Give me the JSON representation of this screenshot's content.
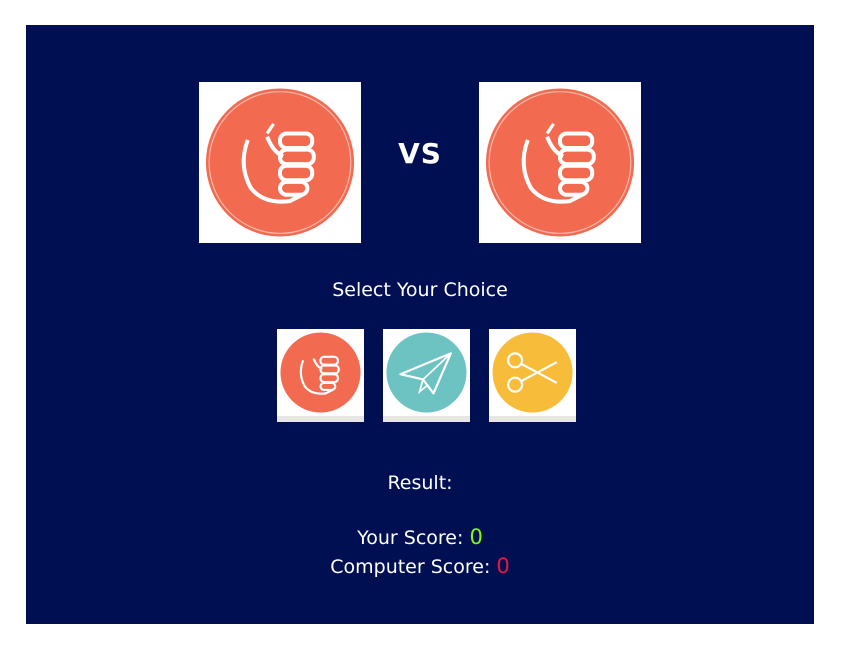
{
  "versus_label": "VS",
  "select_label": "Select Your Choice",
  "result_label": "Result:",
  "player_choice_icon": "rock-fist-icon",
  "computer_choice_icon": "rock-fist-icon",
  "choices": [
    {
      "name": "rock",
      "icon": "rock-fist-icon",
      "color": "#f26a4f"
    },
    {
      "name": "paper",
      "icon": "paper-plane-icon",
      "color": "#6cc3c1"
    },
    {
      "name": "scissors",
      "icon": "scissors-icon",
      "color": "#f7bd3a"
    }
  ],
  "scores": {
    "player_label": "Your Score:",
    "player_value": "0",
    "player_color": "#7cfc00",
    "computer_label": "Computer Score:",
    "computer_value": "0",
    "computer_color": "#e8173b"
  },
  "colors": {
    "panel_background": "#000f52",
    "card_background": "#ffffff"
  }
}
